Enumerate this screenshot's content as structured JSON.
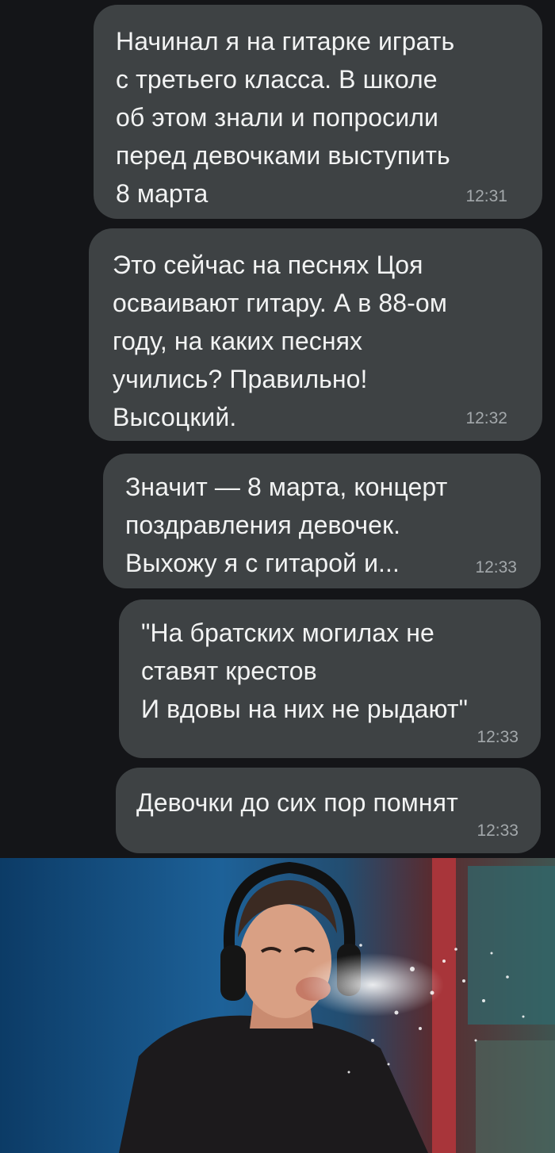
{
  "messages": [
    {
      "text": "Начинал я на гитарке играть\nс третьего класса. В школе\nоб этом знали и попросили\nперед девочками выступить\n8 марта",
      "time": "12:31"
    },
    {
      "text": "Это сейчас на песнях Цоя\nосваивают гитару. А в 88-ом\nгоду, на каких песнях\nучились? Правильно!\nВысоцкий.",
      "time": "12:32"
    },
    {
      "text": "Значит — 8 марта, концерт\nпоздравления девочек.\nВыхожу я с гитарой и...",
      "time": "12:33"
    },
    {
      "text": "\"На братских могилах не\nставят крестов\nИ вдовы на них не рыдают\"",
      "time": "12:33"
    },
    {
      "text": "Девочки до сих пор помнят",
      "time": "12:33"
    }
  ],
  "colors": {
    "background": "#141518",
    "bubble": "#3e4244",
    "text": "#f2f3f3",
    "timestamp": "#a3a8ab"
  }
}
